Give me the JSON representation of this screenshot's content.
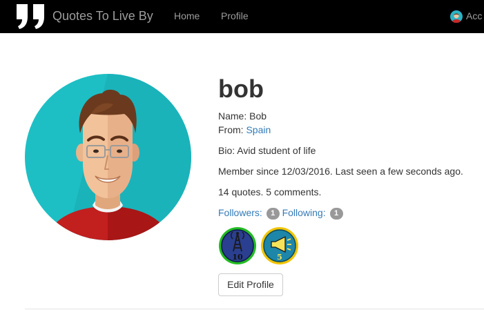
{
  "navbar": {
    "brand": "Quotes To Live By",
    "links": [
      "Home",
      "Profile"
    ],
    "account_label": "Acc"
  },
  "profile": {
    "username": "bob",
    "name_label": "Name:",
    "name": "Bob",
    "from_label": "From:",
    "from": "Spain",
    "bio_label": "Bio:",
    "bio": "Avid student of life",
    "member_line": "Member since 12/03/2016. Last seen a few seconds ago.",
    "counts_line": "14 quotes. 5 comments.",
    "followers_label": "Followers:",
    "followers_count": "1",
    "following_label": "Following:",
    "following_count": "1",
    "edit_button": "Edit Profile"
  },
  "medals": [
    {
      "icon": "antenna-tower-icon",
      "text": "10",
      "ring": "#22bb22",
      "face": "#2a3f8f"
    },
    {
      "icon": "megaphone-icon",
      "text": "5",
      "ring": "#f0c400",
      "face": "#1e86a8"
    }
  ]
}
